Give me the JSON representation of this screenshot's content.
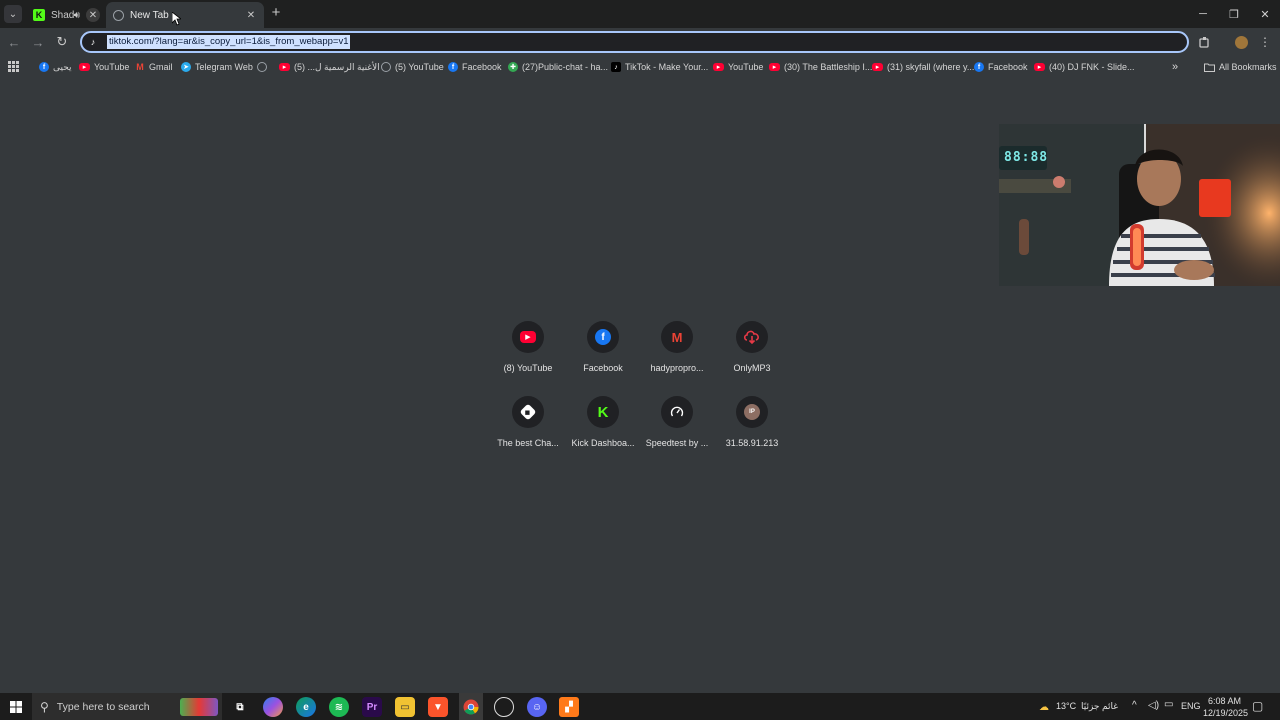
{
  "tabs": [
    {
      "title": "Shad",
      "favicon": "kick-icon",
      "state": "inactive"
    },
    {
      "title": "New Tab",
      "favicon": "globe-icon",
      "state": "active"
    }
  ],
  "omnibox": {
    "url": "tiktok.com/?lang=ar&is_copy_url=1&is_from_webapp=v1"
  },
  "bookmarks": [
    {
      "label": "يحيى",
      "icon": "facebook-icon"
    },
    {
      "label": "YouTube",
      "icon": "youtube-icon"
    },
    {
      "label": "Gmail",
      "icon": "gmail-icon"
    },
    {
      "label": "Telegram Web",
      "icon": "telegram-icon"
    },
    {
      "label": "",
      "icon": "globe-icon"
    },
    {
      "label": "الأغنية الرسمية ل... (5)",
      "icon": "youtube-icon"
    },
    {
      "label": "(5) YouTube",
      "icon": "globe-icon"
    },
    {
      "label": "Facebook",
      "icon": "facebook-icon"
    },
    {
      "label": "(27)Public-chat - ha...",
      "icon": "puzzle-icon"
    },
    {
      "label": "TikTok - Make Your...",
      "icon": "tiktok-icon"
    },
    {
      "label": "YouTube",
      "icon": "youtube-icon"
    },
    {
      "label": "(30) The Battleship I...",
      "icon": "youtube-icon"
    },
    {
      "label": "(31) skyfall (where y...",
      "icon": "youtube-icon"
    },
    {
      "label": "Facebook",
      "icon": "facebook-icon"
    },
    {
      "label": "(40) DJ FNK - Slide...",
      "icon": "youtube-icon"
    }
  ],
  "all_bookmarks_label": "All Bookmarks",
  "shortcuts": [
    {
      "label": "(8) YouTube",
      "icon": "youtube-icon"
    },
    {
      "label": "Facebook",
      "icon": "facebook-icon"
    },
    {
      "label": "hadypropro...",
      "icon": "gmail-icon"
    },
    {
      "label": "OnlyMP3",
      "icon": "cloud-download-icon"
    },
    {
      "label": "The best Cha...",
      "icon": "diamond-icon"
    },
    {
      "label": "Kick Dashboa...",
      "icon": "kick-icon"
    },
    {
      "label": "Speedtest by ...",
      "icon": "speedometer-icon"
    },
    {
      "label": "31.58.91.213",
      "icon": "ip-icon",
      "glyph": "IP"
    }
  ],
  "taskbar": {
    "search_placeholder": "Type here to search",
    "weather": "13°C",
    "weather_desc": "غائم جزئيًا",
    "language": "ENG",
    "time": "6:08 AM",
    "date": "12/19/2025"
  },
  "webcam": {
    "clock_text": "88:88"
  },
  "colors": {
    "kick_green": "#53fc18",
    "youtube_red": "#ff0033",
    "facebook_blue": "#1877f2",
    "omnibox_focus": "#a8c7fa",
    "page_bg": "#35393c"
  }
}
